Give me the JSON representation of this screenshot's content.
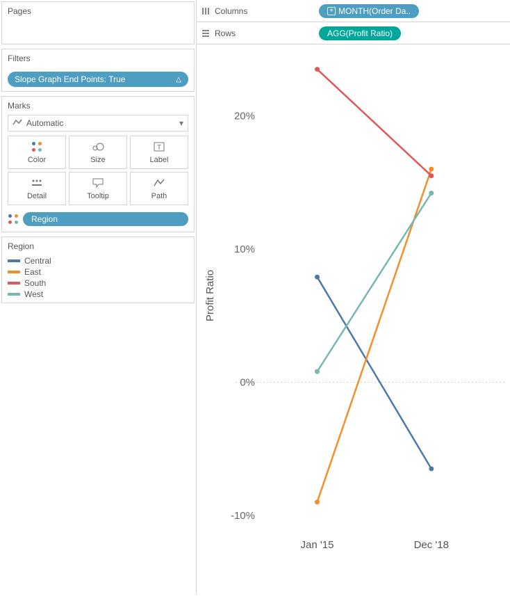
{
  "shelves": {
    "columns_label": "Columns",
    "rows_label": "Rows",
    "columns_pill": "MONTH(Order Da..",
    "rows_pill": "AGG(Profit Ratio)"
  },
  "pages": {
    "title": "Pages"
  },
  "filters": {
    "title": "Filters",
    "pill": "Slope Graph End Points: True"
  },
  "marks": {
    "title": "Marks",
    "type_label": "Automatic",
    "buttons": {
      "color": "Color",
      "size": "Size",
      "label": "Label",
      "detail": "Detail",
      "tooltip": "Tooltip",
      "path": "Path"
    },
    "region_pill": "Region"
  },
  "legend": {
    "title": "Region",
    "items": [
      {
        "label": "Central",
        "color": "#4e79a7"
      },
      {
        "label": "East",
        "color": "#f28e2b"
      },
      {
        "label": "South",
        "color": "#e15759"
      },
      {
        "label": "West",
        "color": "#76b7b2"
      }
    ]
  },
  "chart_data": {
    "type": "line",
    "title": "",
    "xlabel": "",
    "ylabel": "Profit Ratio",
    "ylim": [
      -0.11,
      0.24
    ],
    "yticks": [
      -0.1,
      0.0,
      0.1,
      0.2
    ],
    "ytick_labels": [
      "-10%",
      "0%",
      "10%",
      "20%"
    ],
    "categories": [
      "Jan '15",
      "Dec '18"
    ],
    "series": [
      {
        "name": "Central",
        "color": "#4e79a7",
        "values": [
          0.079,
          -0.065
        ]
      },
      {
        "name": "East",
        "color": "#f28e2b",
        "values": [
          -0.09,
          0.16
        ]
      },
      {
        "name": "South",
        "color": "#e15759",
        "values": [
          0.235,
          0.155
        ]
      },
      {
        "name": "West",
        "color": "#76b7b2",
        "values": [
          0.008,
          0.142
        ]
      }
    ]
  }
}
